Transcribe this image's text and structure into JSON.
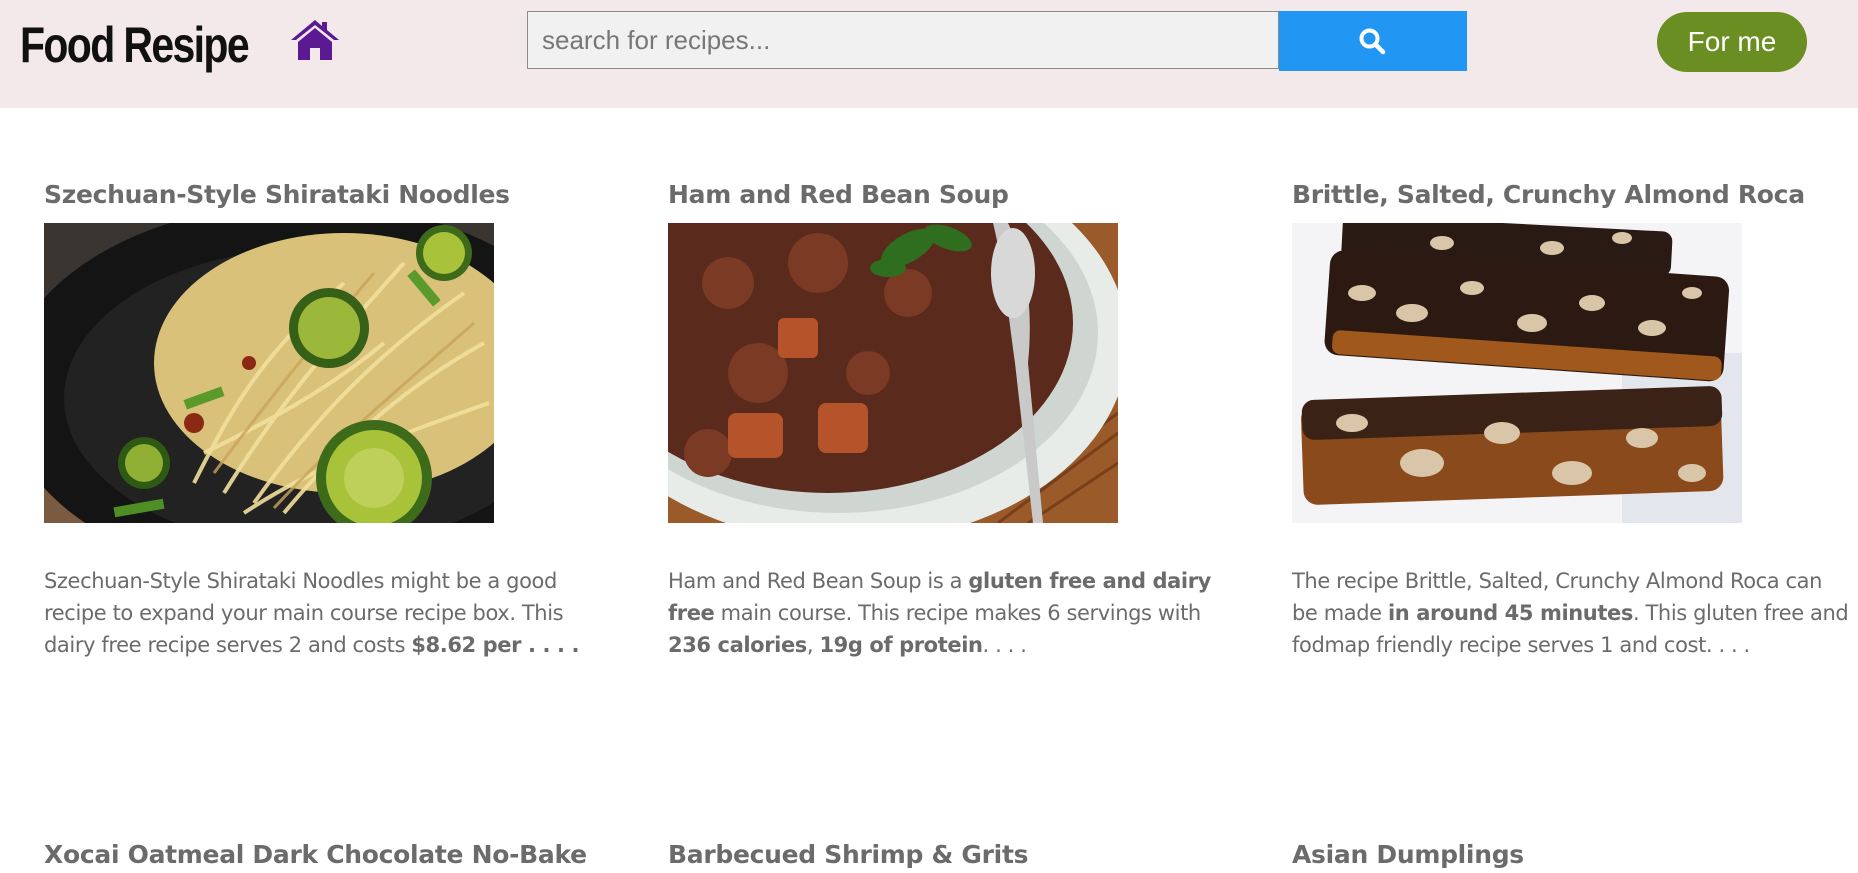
{
  "header": {
    "brand": "Food Resipe",
    "home_icon": "home-icon",
    "search": {
      "placeholder": "search for recipes...",
      "value": ""
    },
    "search_icon": "search-icon",
    "for_me_label": "For me",
    "colors": {
      "bar_bg": "#f3e9ea",
      "home": "#5b1a91",
      "search_button": "#2196f3",
      "for_me": "#6b8e23"
    }
  },
  "recipes": [
    {
      "title": "Szechuan-Style Shirataki Noodles",
      "desc": [
        {
          "t": "Szechuan-Style Shirataki Noodles might be a good recipe to expand your main course recipe box. This dairy free recipe serves 2 and costs ",
          "b": false
        },
        {
          "t": "$8.62 per . . . .",
          "b": true
        }
      ]
    },
    {
      "title": "Ham and Red Bean Soup",
      "desc": [
        {
          "t": "Ham and Red Bean Soup is a ",
          "b": false
        },
        {
          "t": "gluten free and dairy free",
          "b": true
        },
        {
          "t": " main course. This recipe makes 6 servings with ",
          "b": false
        },
        {
          "t": "236 calories",
          "b": true
        },
        {
          "t": ", ",
          "b": false
        },
        {
          "t": "19g of protein",
          "b": true
        },
        {
          "t": ". . . .",
          "b": false
        }
      ]
    },
    {
      "title": "Brittle, Salted, Crunchy Almond Roca",
      "desc": [
        {
          "t": "The recipe Brittle, Salted, Crunchy Almond Roca can be made ",
          "b": false
        },
        {
          "t": "in around 45 minutes",
          "b": true
        },
        {
          "t": ". This gluten free and fodmap friendly recipe serves 1 and cost. . . .",
          "b": false
        }
      ]
    },
    {
      "title": "Xocai Oatmeal Dark Chocolate No-Bake"
    },
    {
      "title": "Barbecued Shrimp & Grits"
    },
    {
      "title": "Asian Dumplings"
    }
  ]
}
